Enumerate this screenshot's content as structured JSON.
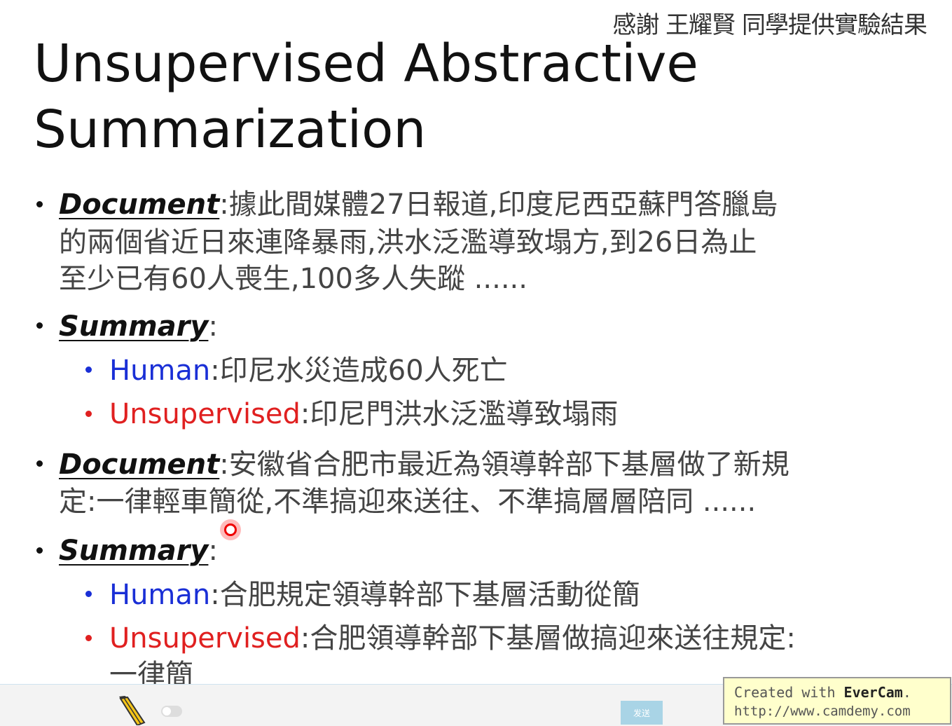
{
  "credit": "感謝 王耀賢 同學提供實驗結果",
  "title": "Unsupervised Abstractive Summarization",
  "items": [
    {
      "label": "Document",
      "colon": ":",
      "line1": "據此間媒體27日報道,印度尼西亞蘇門答臘島",
      "line2": "的兩個省近日來連降暴雨,洪水泛濫導致塌方,到26日為止",
      "line3": "至少已有60人喪生,100多人失蹤 ......"
    },
    {
      "label": "Summary",
      "colon": ":",
      "human_label": "Human",
      "human_text": ":印尼水災造成60人死亡",
      "unsup_label": "Unsupervised",
      "unsup_text": ":印尼門洪水泛濫導致塌雨"
    },
    {
      "label": "Document",
      "colon": ":",
      "line1": "安徽省合肥市最近為領導幹部下基層做了新規",
      "line2": "定:一律輕車簡從,不準搞迎來送往、不準搞層層陪同 ......"
    },
    {
      "label": "Summary",
      "colon": ":",
      "human_label": "Human",
      "human_text": ":合肥規定領導幹部下基層活動從簡",
      "unsup_label": "Unsupervised",
      "unsup_text": ":合肥領導幹部下基層做搞迎來送往規定:",
      "unsup_text2": "一律簡"
    }
  ],
  "bottom_bar": {
    "send_label": "发送"
  },
  "watermark": {
    "line1_prefix": "Created with ",
    "line1_brand": "EverCam",
    "line1_suffix": ".",
    "line2": "http://www.camdemy.com"
  },
  "colors": {
    "human": "#1a2fd6",
    "unsupervised": "#e02020"
  }
}
